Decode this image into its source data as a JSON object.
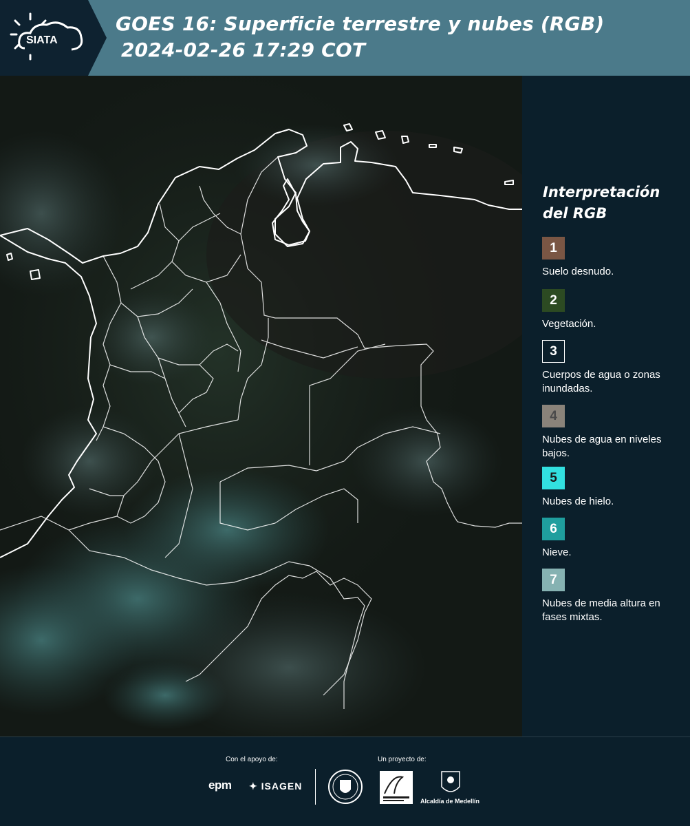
{
  "header": {
    "logo_text": "SIATA",
    "title_line1": "GOES 16: Superficie terrestre y nubes (RGB)",
    "title_line2": "2024-02-26 17:29 COT"
  },
  "legend": {
    "title": "Interpretación del RGB",
    "items": [
      {
        "number": "1",
        "label": "Suelo desnudo.",
        "color": "#7a5644"
      },
      {
        "number": "2",
        "label": "Vegetación.",
        "color": "#2c4a22"
      },
      {
        "number": "3",
        "label": "Cuerpos de agua o zonas inundadas.",
        "color": "#0b1f2b"
      },
      {
        "number": "4",
        "label": "Nubes de agua en niveles bajos.",
        "color": "#8a837a"
      },
      {
        "number": "5",
        "label": "Nubes de hielo.",
        "color": "#32e0e0"
      },
      {
        "number": "6",
        "label": "Nieve.",
        "color": "#1f9e9e"
      },
      {
        "number": "7",
        "label": "Nubes de media altura en fases mixtas.",
        "color": "#86b2b2"
      }
    ]
  },
  "footer": {
    "support_label": "Con el apoyo de:",
    "project_label": "Un proyecto de:",
    "epm": "epm",
    "isagen": "ISAGEN",
    "alcaldia": "Alcaldía de Medellín"
  },
  "map": {
    "land_color": "#1a2a1f",
    "cloud_color": "#3a6e6e",
    "border_color": "#ffffff"
  }
}
